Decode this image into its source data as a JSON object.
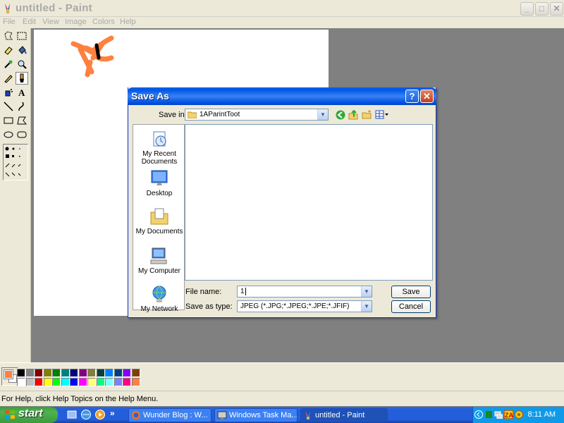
{
  "window": {
    "title": "untitled - Paint",
    "controls": {
      "minimize": "_",
      "maximize": "□",
      "close": "✕"
    }
  },
  "menu": [
    "File",
    "Edit",
    "View",
    "Image",
    "Colors",
    "Help"
  ],
  "tools": [
    "free-form-select",
    "select",
    "eraser",
    "fill-with-color",
    "pick-color",
    "magnifier",
    "pencil",
    "brush",
    "airbrush",
    "text",
    "line",
    "curve",
    "rectangle",
    "polygon",
    "ellipse",
    "rounded-rectangle"
  ],
  "colors": {
    "foreground": "#FF8040",
    "background": "#FFFFFF",
    "palette_top": [
      "#000000",
      "#808080",
      "#800000",
      "#808000",
      "#008000",
      "#008080",
      "#000080",
      "#800080",
      "#808040",
      "#004040",
      "#0080FF",
      "#004080",
      "#8000FF",
      "#804000"
    ],
    "palette_bottom": [
      "#FFFFFF",
      "#C0C0C0",
      "#FF0000",
      "#FFFF00",
      "#00FF00",
      "#00FFFF",
      "#0000FF",
      "#FF00FF",
      "#FFFF80",
      "#00FF80",
      "#80FFFF",
      "#8080FF",
      "#FF0080",
      "#FF8040"
    ]
  },
  "status": "For Help, click Help Topics on the Help Menu.",
  "dialog": {
    "title": "Save As",
    "help": "?",
    "close": "✕",
    "save_in_label": "Save in:",
    "save_in_value": "1AParintToot",
    "places": [
      "My Recent Documents",
      "Desktop",
      "My Documents",
      "My Computer",
      "My Network"
    ],
    "file_name_label": "File name:",
    "file_name_value": "1",
    "save_as_type_label": "Save as type:",
    "save_as_type_value": "JPEG (*.JPG;*.JPEG;*.JPE;*.JFIF)",
    "save_button": "Save",
    "cancel_button": "Cancel"
  },
  "taskbar": {
    "start": "start",
    "more": "»",
    "tasks": [
      {
        "label": "Wunder Blog : W...",
        "active": false
      },
      {
        "label": "Windows Task Ma...",
        "active": false
      },
      {
        "label": "untitled - Paint",
        "active": true
      }
    ],
    "clock": "8:11 AM"
  }
}
